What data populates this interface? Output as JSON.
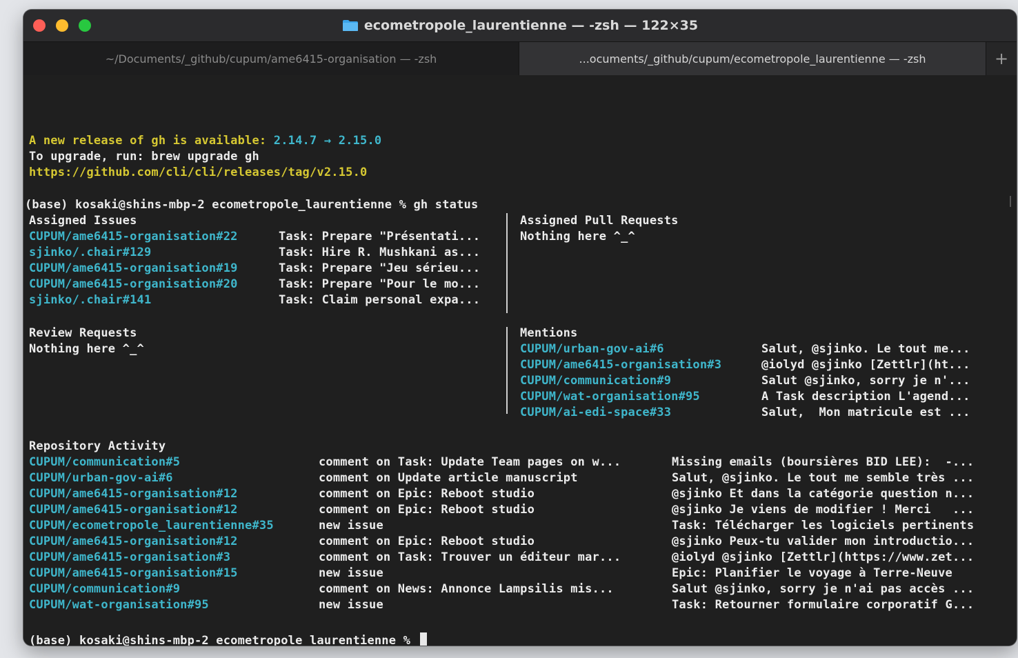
{
  "window": {
    "title": "ecometropole_laurentienne — -zsh — 122×35",
    "title_icon": "folder-icon",
    "controls": [
      "close",
      "minimize",
      "zoom"
    ]
  },
  "tabs": [
    {
      "label": "~/Documents/_github/cupum/ame6415-organisation — -zsh",
      "active": false
    },
    {
      "label": "...ocuments/_github/cupum/ecometropole_laurentienne — -zsh",
      "active": true
    }
  ],
  "new_tab_label": "+",
  "terminal": {
    "release_prefix": "A new release of gh is available: ",
    "release_version": "2.14.7 → 2.15.0",
    "upgrade_line": "To upgrade, run: brew upgrade gh",
    "release_url": "https://github.com/cli/cli/releases/tag/v2.15.0",
    "prompt_command": "(base) kosaki@shins-mbp-2 ecometropole_laurentienne % gh status",
    "assigned_issues": {
      "heading": "Assigned Issues",
      "items": [
        {
          "ref": "CUPUM/ame6415-organisation#22",
          "text": "Task: Prepare \"Présentati..."
        },
        {
          "ref": "sjinko/.chair#129",
          "text": "Task: Hire R. Mushkani as..."
        },
        {
          "ref": "CUPUM/ame6415-organisation#19",
          "text": "Task: Prepare \"Jeu sérieu..."
        },
        {
          "ref": "CUPUM/ame6415-organisation#20",
          "text": "Task: Prepare \"Pour le mo..."
        },
        {
          "ref": "sjinko/.chair#141",
          "text": "Task: Claim personal expa..."
        }
      ]
    },
    "assigned_prs": {
      "heading": "Assigned Pull Requests",
      "empty": "Nothing here ^_^"
    },
    "review_requests": {
      "heading": "Review Requests",
      "empty": "Nothing here ^_^"
    },
    "mentions": {
      "heading": "Mentions",
      "items": [
        {
          "ref": "CUPUM/urban-gov-ai#6",
          "text": "Salut, @sjinko. Le tout me..."
        },
        {
          "ref": "CUPUM/ame6415-organisation#3",
          "text": "@iolyd @sjinko [Zettlr](ht..."
        },
        {
          "ref": "CUPUM/communication#9",
          "text": "Salut @sjinko, sorry je n'..."
        },
        {
          "ref": "CUPUM/wat-organisation#95",
          "text": "A Task description L'agend..."
        },
        {
          "ref": "CUPUM/ai-edi-space#33",
          "text": "Salut,  Mon matricule est ..."
        }
      ]
    },
    "repo_activity": {
      "heading": "Repository Activity",
      "items": [
        {
          "ref": "CUPUM/communication#5",
          "action": "comment on Task: Update Team pages on w...",
          "text": "Missing emails (boursières BID LEE):  -..."
        },
        {
          "ref": "CUPUM/urban-gov-ai#6",
          "action": "comment on Update article manuscript",
          "text": "Salut, @sjinko. Le tout me semble très ..."
        },
        {
          "ref": "CUPUM/ame6415-organisation#12",
          "action": "comment on Epic: Reboot studio",
          "text": "@sjinko Et dans la catégorie question n..."
        },
        {
          "ref": "CUPUM/ame6415-organisation#12",
          "action": "comment on Epic: Reboot studio",
          "text": "@sjinko Je viens de modifier ! Merci   ..."
        },
        {
          "ref": "CUPUM/ecometropole_laurentienne#35",
          "action": "new issue",
          "text": "Task: Télécharger les logiciels pertinents"
        },
        {
          "ref": "CUPUM/ame6415-organisation#12",
          "action": "comment on Epic: Reboot studio",
          "text": "@sjinko Peux-tu valider mon introductio..."
        },
        {
          "ref": "CUPUM/ame6415-organisation#3",
          "action": "comment on Task: Trouver un éditeur mar...",
          "text": "@iolyd @sjinko [Zettlr](https://www.zet..."
        },
        {
          "ref": "CUPUM/ame6415-organisation#15",
          "action": "new issue",
          "text": "Epic: Planifier le voyage à Terre-Neuve"
        },
        {
          "ref": "CUPUM/communication#9",
          "action": "comment on News: Annonce Lampsilis mis...",
          "text": "Salut @sjinko, sorry je n'ai pas accès ..."
        },
        {
          "ref": "CUPUM/wat-organisation#95",
          "action": "new issue",
          "text": "Task: Retourner formulaire corporatif G..."
        }
      ]
    },
    "final_prompt": "(base) kosaki@shins-mbp-2 ecometropole_laurentienne % "
  },
  "colors": {
    "link": "#3fb7cc",
    "notice": "#d6c832",
    "text": "#ececec",
    "background": "#1f1f1f"
  }
}
